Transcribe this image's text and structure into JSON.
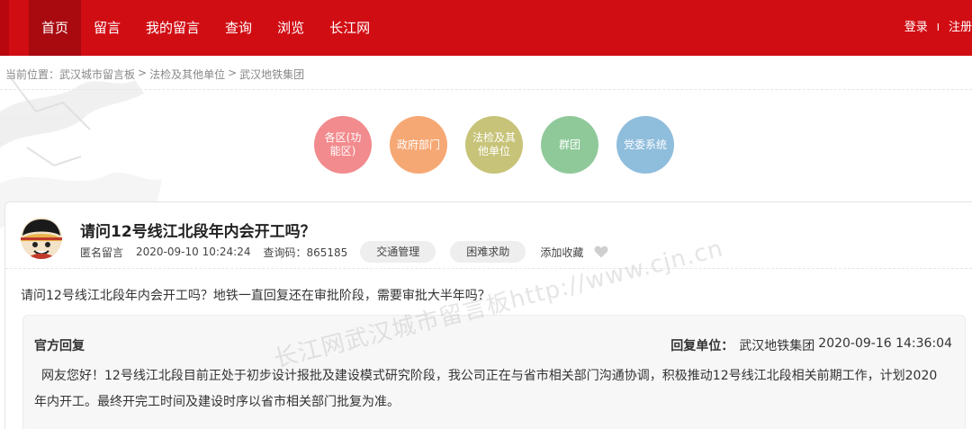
{
  "nav": {
    "items": [
      {
        "label": "首页",
        "active": true
      },
      {
        "label": "留言"
      },
      {
        "label": "我的留言"
      },
      {
        "label": "查询"
      },
      {
        "label": "浏览"
      },
      {
        "label": "长江网"
      }
    ],
    "login": "登录",
    "separator": "I",
    "register": "注册"
  },
  "breadcrumb": {
    "prefix": "当前位置：",
    "items": [
      "武汉城市留言板",
      "法检及其他单位",
      "武汉地铁集团"
    ],
    "separator": ">"
  },
  "categories": [
    {
      "label": "各区(功能区)",
      "color": "#f28b8e"
    },
    {
      "label": "政府部门",
      "color": "#f6a874"
    },
    {
      "label": "法检及其他单位",
      "color": "#c7c378"
    },
    {
      "label": "群团",
      "color": "#8fc99a"
    },
    {
      "label": "党委系统",
      "color": "#8fbddc"
    }
  ],
  "post": {
    "title": "请问12号线江北段年内会开工吗？",
    "author": "匿名留言",
    "datetime": "2020-09-10 10:24:24",
    "query_code": "查询码：865185",
    "tags": [
      "交通管理",
      "困难求助"
    ],
    "favorite": "添加收藏",
    "body": "请问12号线江北段年内会开工吗？地铁一直回复还在审批阶段，需要审批大半年吗？"
  },
  "reply": {
    "title": "官方回复",
    "unit_label": "回复单位：",
    "unit": "武汉地铁集团",
    "datetime": "2020-09-16 14:36:04",
    "text": "网友您好！12号线江北段目前正处于初步设计报批及建设模式研究阶段，我公司正在与省市相关部门沟通协调，积极推动12号线江北段相关前期工作，计划2020年内开工。最终开完工时间及建设时序以省市相关部门批复为准。"
  },
  "watermark": "长江网武汉城市留言板http://www.cjn.cn",
  "colors": {
    "brand_red": "#d10d14",
    "nav_active": "#a80a10"
  }
}
